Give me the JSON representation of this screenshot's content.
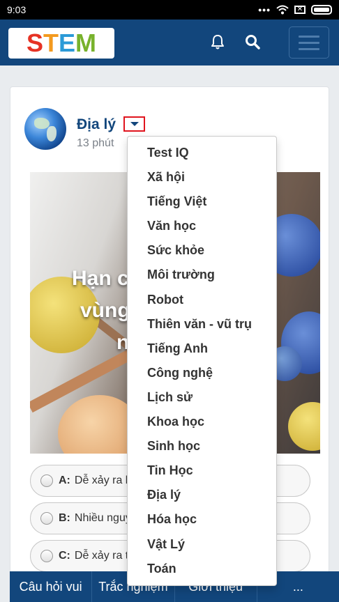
{
  "status": {
    "time": "9:03",
    "dots": "•••",
    "sim_icon": "x-box-icon"
  },
  "header": {
    "logo_letters": [
      "S",
      "T",
      "E",
      "M"
    ],
    "bell_icon": "bell-icon",
    "search_icon": "search-icon",
    "menu_icon": "hamburger-icon"
  },
  "post": {
    "category": "Địa lý",
    "time": "13 phút",
    "hero_lines": [
      "Hạn ch",
      "vùng",
      "n"
    ],
    "answers": [
      {
        "letter": "A:",
        "text": "Dễ xảy ra l"
      },
      {
        "letter": "B:",
        "text": "Nhiều nguy"
      },
      {
        "letter": "C:",
        "text": "Dễ xảy ra t"
      }
    ]
  },
  "bottom_nav": [
    "Câu hỏi vui",
    "Trắc nghiệm",
    "Giới thiệu",
    "..."
  ],
  "dropdown": {
    "items": [
      "Test IQ",
      "Xã hội",
      "Tiếng Việt",
      "Văn học",
      "Sức khỏe",
      "Môi trường",
      "Robot",
      "Thiên văn - vũ trụ",
      "Tiếng Anh",
      "Công nghệ",
      "Lịch sử",
      "Khoa học",
      "Sinh học",
      "Tin Học",
      "Địa lý",
      "Hóa học",
      "Vật Lý",
      "Toán"
    ]
  },
  "colors": {
    "primary": "#12467c",
    "highlight": "#e0141e"
  }
}
